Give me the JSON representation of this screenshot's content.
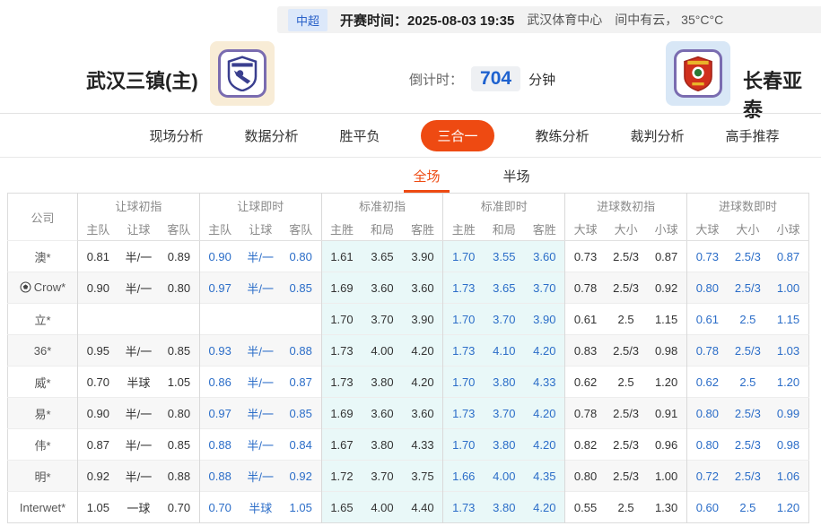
{
  "top_bar": {
    "league": "中超",
    "kickoff_label": "开赛时间：",
    "kickoff_time": "2025-08-03 19:35",
    "venue": "武汉体育中心",
    "weather": "间中有云， 35°C°C"
  },
  "match": {
    "home_name": "武汉三镇(主)",
    "away_name": "长春亚泰",
    "home_logo_icon": "wuhan-crest-blue-shield",
    "away_logo_icon": "changchun-crest-red-shield",
    "countdown_label": "倒计时：",
    "countdown_value": "704",
    "countdown_unit": "分钟"
  },
  "nav": {
    "items": [
      {
        "label": "现场分析",
        "active": false
      },
      {
        "label": "数据分析",
        "active": false
      },
      {
        "label": "胜平负",
        "active": false
      },
      {
        "label": "三合一",
        "active": true
      },
      {
        "label": "教练分析",
        "active": false
      },
      {
        "label": "裁判分析",
        "active": false
      },
      {
        "label": "高手推荐",
        "active": false
      }
    ]
  },
  "sub_tabs": [
    {
      "label": "全场",
      "active": true
    },
    {
      "label": "半场",
      "active": false
    }
  ],
  "table": {
    "company_header": "公司",
    "groups": [
      {
        "title": "让球初指",
        "cols": [
          "主队",
          "让球",
          "客队"
        ]
      },
      {
        "title": "让球即时",
        "cols": [
          "主队",
          "让球",
          "客队"
        ]
      },
      {
        "title": "标准初指",
        "cols": [
          "主胜",
          "和局",
          "客胜"
        ]
      },
      {
        "title": "标准即时",
        "cols": [
          "主胜",
          "和局",
          "客胜"
        ]
      },
      {
        "title": "进球数初指",
        "cols": [
          "大球",
          "大小",
          "小球"
        ]
      },
      {
        "title": "进球数即时",
        "cols": [
          "大球",
          "大小",
          "小球"
        ]
      }
    ],
    "rows": [
      {
        "company": "澳*",
        "icon": null,
        "cells": [
          [
            "0.81",
            "半/一",
            "0.89"
          ],
          [
            "0.90",
            "半/一",
            "0.80"
          ],
          [
            "1.61",
            "3.65",
            "3.90"
          ],
          [
            "1.70",
            "3.55",
            "3.60"
          ],
          [
            "0.73",
            "2.5/3",
            "0.87"
          ],
          [
            "0.73",
            "2.5/3",
            "0.87"
          ]
        ]
      },
      {
        "company": "Crow*",
        "icon": "soccer-ball-icon",
        "cells": [
          [
            "0.90",
            "半/一",
            "0.80"
          ],
          [
            "0.97",
            "半/一",
            "0.85"
          ],
          [
            "1.69",
            "3.60",
            "3.60"
          ],
          [
            "1.73",
            "3.65",
            "3.70"
          ],
          [
            "0.78",
            "2.5/3",
            "0.92"
          ],
          [
            "0.80",
            "2.5/3",
            "1.00"
          ]
        ]
      },
      {
        "company": "立*",
        "icon": null,
        "cells": [
          [
            "",
            "",
            ""
          ],
          [
            "",
            "",
            ""
          ],
          [
            "1.70",
            "3.70",
            "3.90"
          ],
          [
            "1.70",
            "3.70",
            "3.90"
          ],
          [
            "0.61",
            "2.5",
            "1.15"
          ],
          [
            "0.61",
            "2.5",
            "1.15"
          ]
        ]
      },
      {
        "company": "36*",
        "icon": null,
        "cells": [
          [
            "0.95",
            "半/一",
            "0.85"
          ],
          [
            "0.93",
            "半/一",
            "0.88"
          ],
          [
            "1.73",
            "4.00",
            "4.20"
          ],
          [
            "1.73",
            "4.10",
            "4.20"
          ],
          [
            "0.83",
            "2.5/3",
            "0.98"
          ],
          [
            "0.78",
            "2.5/3",
            "1.03"
          ]
        ]
      },
      {
        "company": "威*",
        "icon": null,
        "cells": [
          [
            "0.70",
            "半球",
            "1.05"
          ],
          [
            "0.86",
            "半/一",
            "0.87"
          ],
          [
            "1.73",
            "3.80",
            "4.20"
          ],
          [
            "1.70",
            "3.80",
            "4.33"
          ],
          [
            "0.62",
            "2.5",
            "1.20"
          ],
          [
            "0.62",
            "2.5",
            "1.20"
          ]
        ]
      },
      {
        "company": "易*",
        "icon": null,
        "cells": [
          [
            "0.90",
            "半/一",
            "0.80"
          ],
          [
            "0.97",
            "半/一",
            "0.85"
          ],
          [
            "1.69",
            "3.60",
            "3.60"
          ],
          [
            "1.73",
            "3.70",
            "4.20"
          ],
          [
            "0.78",
            "2.5/3",
            "0.91"
          ],
          [
            "0.80",
            "2.5/3",
            "0.99"
          ]
        ]
      },
      {
        "company": "伟*",
        "icon": null,
        "cells": [
          [
            "0.87",
            "半/一",
            "0.85"
          ],
          [
            "0.88",
            "半/一",
            "0.84"
          ],
          [
            "1.67",
            "3.80",
            "4.33"
          ],
          [
            "1.70",
            "3.80",
            "4.20"
          ],
          [
            "0.82",
            "2.5/3",
            "0.96"
          ],
          [
            "0.80",
            "2.5/3",
            "0.98"
          ]
        ]
      },
      {
        "company": "明*",
        "icon": null,
        "cells": [
          [
            "0.92",
            "半/一",
            "0.88"
          ],
          [
            "0.88",
            "半/一",
            "0.92"
          ],
          [
            "1.72",
            "3.70",
            "3.75"
          ],
          [
            "1.66",
            "4.00",
            "4.35"
          ],
          [
            "0.80",
            "2.5/3",
            "1.00"
          ],
          [
            "0.72",
            "2.5/3",
            "1.06"
          ]
        ]
      },
      {
        "company": "Interwet*",
        "icon": null,
        "cells": [
          [
            "1.05",
            "一球",
            "0.70"
          ],
          [
            "0.70",
            "半球",
            "1.05"
          ],
          [
            "1.65",
            "4.00",
            "4.40"
          ],
          [
            "1.73",
            "3.80",
            "4.20"
          ],
          [
            "0.55",
            "2.5",
            "1.30"
          ],
          [
            "0.60",
            "2.5",
            "1.20"
          ]
        ]
      }
    ]
  },
  "colors": {
    "accent_orange": "#ee4a12",
    "live_blue": "#2b6dc8",
    "standard_col_bg": "#e9f8f8",
    "league_badge_blue": "#2b62c9",
    "countdown_blue": "#1f62cf"
  }
}
